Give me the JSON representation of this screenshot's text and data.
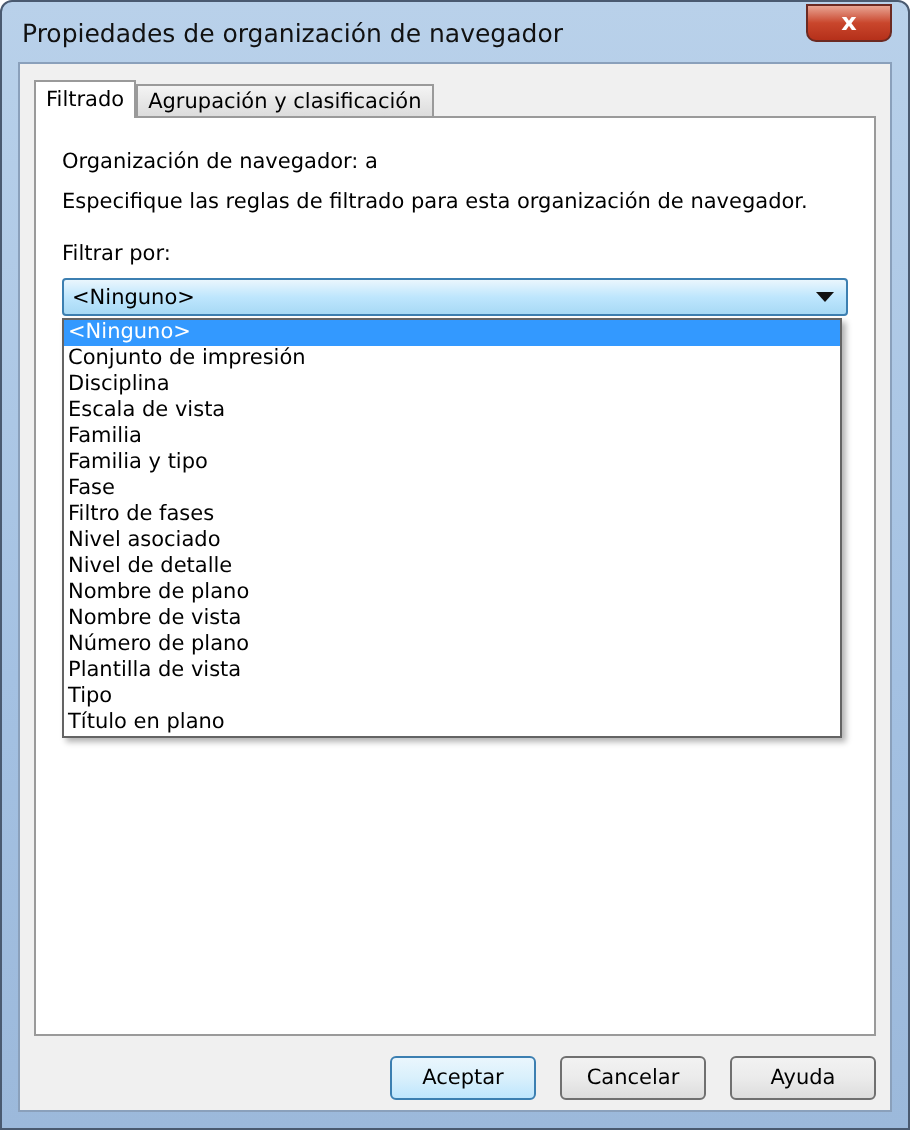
{
  "window": {
    "title": "Propiedades de organización de navegador",
    "close": "x"
  },
  "tabs": [
    {
      "label": "Filtrado",
      "selected": true
    },
    {
      "label": "Agrupación y clasificación",
      "selected": false
    }
  ],
  "info": "Organización de navegador: a",
  "description": "Especifique las reglas de filtrado para esta organización de navegador.",
  "filter": {
    "label": "Filtrar por:",
    "value": "<Ninguno>",
    "expanded": true,
    "options": [
      {
        "label": "<Ninguno>",
        "selected": true
      },
      {
        "label": "Conjunto de impresión",
        "selected": false
      },
      {
        "label": "Disciplina",
        "selected": false
      },
      {
        "label": "Escala de vista",
        "selected": false
      },
      {
        "label": "Familia",
        "selected": false
      },
      {
        "label": "Familia y tipo",
        "selected": false
      },
      {
        "label": "Fase",
        "selected": false
      },
      {
        "label": "Filtro de fases",
        "selected": false
      },
      {
        "label": "Nivel asociado",
        "selected": false
      },
      {
        "label": "Nivel de detalle",
        "selected": false
      },
      {
        "label": "Nombre de plano",
        "selected": false
      },
      {
        "label": "Nombre de vista",
        "selected": false
      },
      {
        "label": "Número de plano",
        "selected": false
      },
      {
        "label": "Plantilla de vista",
        "selected": false
      },
      {
        "label": "Tipo",
        "selected": false
      },
      {
        "label": "Título en plano",
        "selected": false
      }
    ]
  },
  "buttons": [
    {
      "label": "Aceptar",
      "default": true
    },
    {
      "label": "Cancelar",
      "default": false
    },
    {
      "label": "Ayuda",
      "default": false
    }
  ]
}
